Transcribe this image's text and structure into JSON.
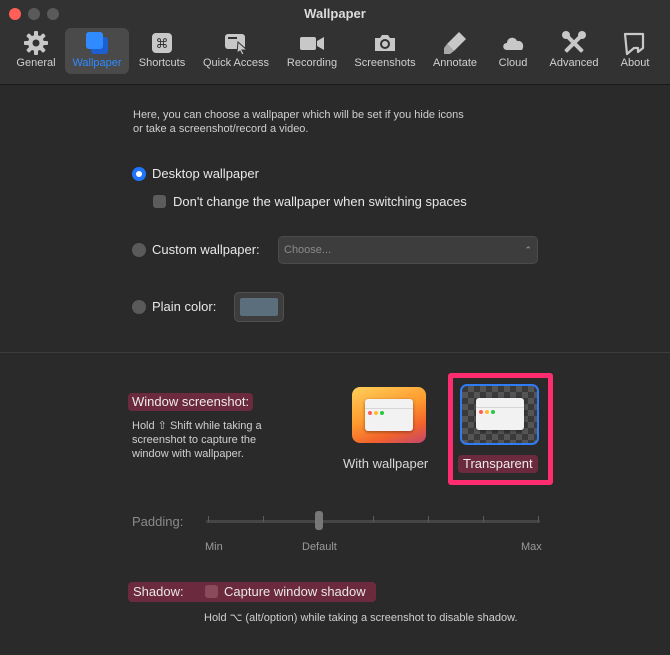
{
  "window": {
    "title": "Wallpaper"
  },
  "toolbar": {
    "tabs": [
      {
        "label": "General",
        "icon": "gear-icon"
      },
      {
        "label": "Wallpaper",
        "icon": "wallpaper-icon",
        "active": true
      },
      {
        "label": "Shortcuts",
        "icon": "command-key-icon"
      },
      {
        "label": "Quick Access",
        "icon": "quick-access-icon"
      },
      {
        "label": "Recording",
        "icon": "video-camera-icon"
      },
      {
        "label": "Screenshots",
        "icon": "camera-icon"
      },
      {
        "label": "Annotate",
        "icon": "marker-icon"
      },
      {
        "label": "Cloud",
        "icon": "cloud-icon"
      },
      {
        "label": "Advanced",
        "icon": "tools-icon"
      },
      {
        "label": "About",
        "icon": "info-flag-icon"
      }
    ],
    "accent_color": "#2f8bff"
  },
  "intro": {
    "line1": "Here, you can choose a wallpaper which will be set if you hide icons",
    "line2": "or take a screenshot/record a video."
  },
  "wallpaper_options": {
    "desktop": {
      "label": "Desktop wallpaper",
      "selected": true
    },
    "dont_change": {
      "label": "Don't change the wallpaper when switching spaces",
      "checked": false
    },
    "custom": {
      "label": "Custom wallpaper:",
      "selected": false,
      "placeholder": "Choose..."
    },
    "plain": {
      "label": "Plain color:",
      "selected": false,
      "color": "#5b6e7c"
    }
  },
  "window_screenshot": {
    "heading": "Window screenshot:",
    "desc_line1": "Hold ⇧ Shift while taking a",
    "desc_line2": "screenshot to capture the",
    "desc_line3": "window with wallpaper.",
    "option_with": "With wallpaper",
    "option_transparent": "Transparent",
    "selected": "Transparent"
  },
  "padding": {
    "label": "Padding:",
    "min": "Min",
    "default": "Default",
    "max": "Max",
    "value_fraction": 0.34
  },
  "shadow": {
    "heading": "Shadow:",
    "checkbox_label": "Capture window shadow",
    "checked": false,
    "note": "Hold ⌥ (alt/option) while taking a screenshot to disable shadow."
  }
}
